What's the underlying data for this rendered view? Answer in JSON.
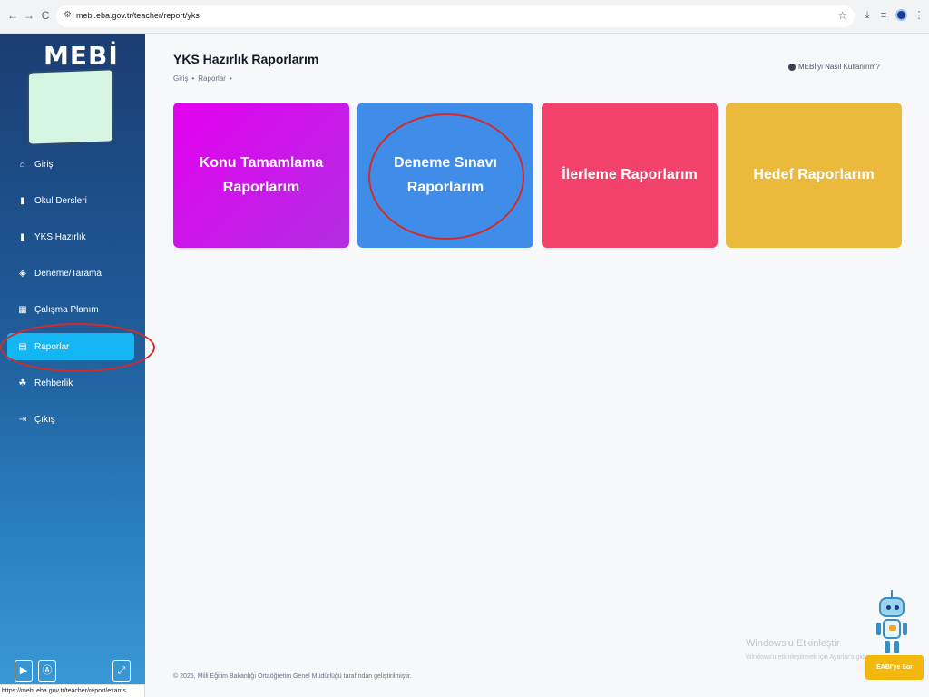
{
  "browser": {
    "url": "mebi.eba.gov.tr/teacher/report/yks",
    "status_url": "https://mebi.eba.gov.tr/teacher/report/exams",
    "icons": {
      "back": "back-arrow-icon",
      "forward": "forward-arrow-icon",
      "reload": "reload-icon",
      "site_info": "tune-icon",
      "bookmark": "star-icon",
      "download": "download-icon",
      "extensions": "extensions-icon",
      "profile": "profile-avatar",
      "menu": "kebab-menu-icon"
    }
  },
  "sidebar": {
    "logo": "MEBİ",
    "items": [
      {
        "label": "Giriş",
        "icon": "home-icon"
      },
      {
        "label": "Okul Dersleri",
        "icon": "book-icon"
      },
      {
        "label": "YKS Hazırlık",
        "icon": "book-icon"
      },
      {
        "label": "Deneme/Tarama",
        "icon": "layers-icon"
      },
      {
        "label": "Çalışma Planım",
        "icon": "calendar-icon"
      },
      {
        "label": "Raporlar",
        "icon": "report-icon",
        "active": true
      },
      {
        "label": "Rehberlik",
        "icon": "people-icon"
      },
      {
        "label": "Çıkış",
        "icon": "logout-icon"
      }
    ],
    "bottom_buttons": [
      "play-store-icon",
      "app-store-icon",
      "collapse-icon"
    ]
  },
  "header": {
    "title": "YKS Hazırlık Raporlarım",
    "breadcrumb": [
      "Giriş",
      "•",
      "Raporlar",
      "•"
    ],
    "help_label": "MEBİ'yi Nasıl Kullanırım?"
  },
  "cards": [
    {
      "label": "Konu Tamamlama Raporlarım",
      "color": "#d91ff0"
    },
    {
      "label": "Deneme Sınavı Raporlarım",
      "color": "#3f8de8"
    },
    {
      "label": "İlerleme Raporlarım",
      "color": "#f2416a"
    },
    {
      "label": "Hedef Raporlarım",
      "color": "#ebb93c"
    }
  ],
  "footer": "© 2025, Milli Eğitim Bakanlığı Ortaöğretim Genel Müdürlüğü tarafından geliştirilmiştir.",
  "watermark": {
    "title": "Windows'u Etkinleştir",
    "subtitle": "Windows'u etkinleştirmek için Ayarlar'a gidin."
  },
  "chat_button": "EABİ'ye Sor",
  "annotations": {
    "color": "#d32b2b"
  }
}
